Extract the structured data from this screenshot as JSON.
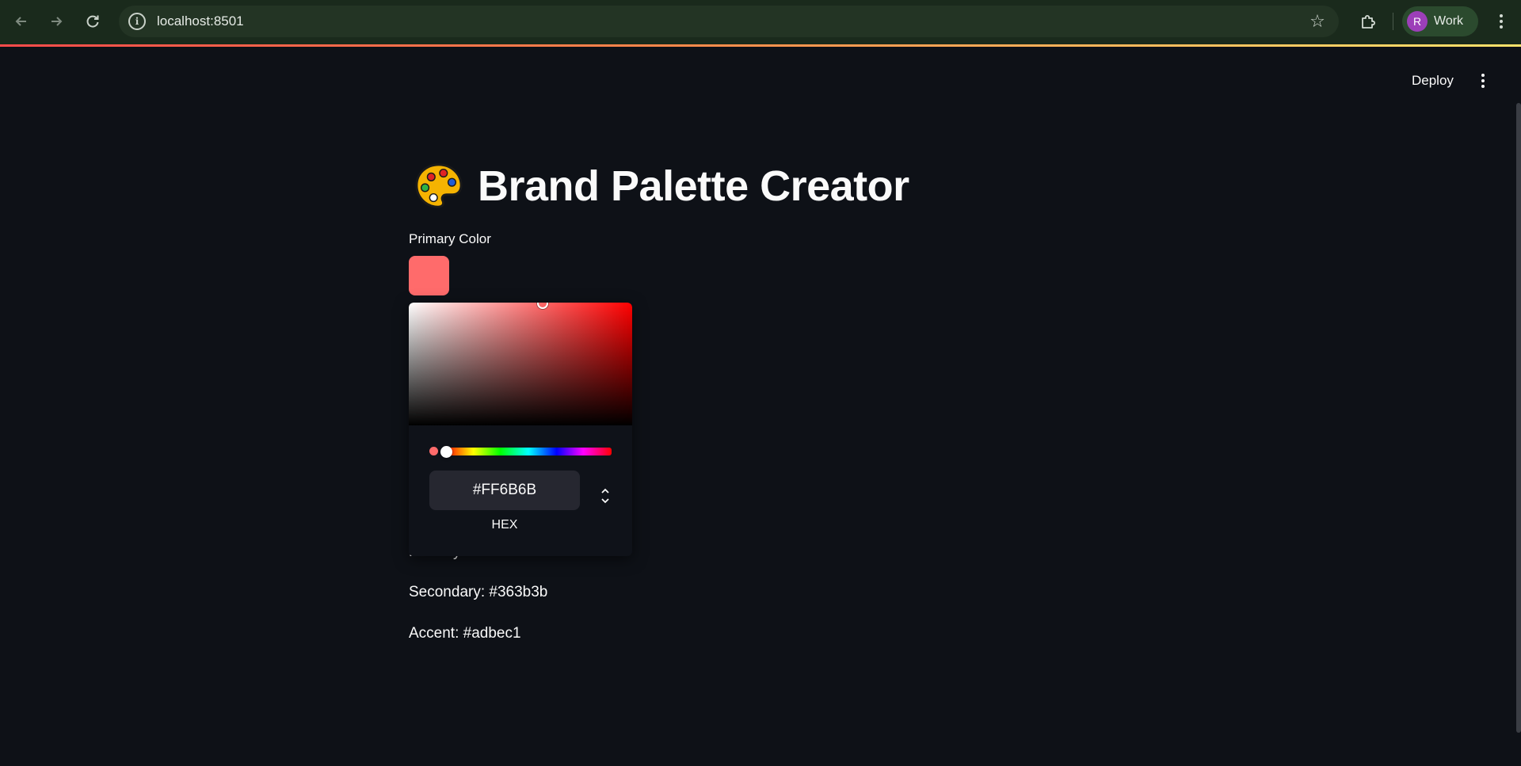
{
  "browser": {
    "url": "localhost:8501",
    "profile_initial": "R",
    "profile_name": "Work",
    "icons": {
      "back": "arrow-left-icon",
      "forward": "arrow-right-icon",
      "reload": "reload-icon",
      "site_info": "info-icon",
      "bookmark": "star-icon",
      "extensions": "puzzle-icon",
      "menu": "kebab-menu-icon"
    }
  },
  "app_header": {
    "deploy_label": "Deploy"
  },
  "page": {
    "title": "Brand Palette Creator",
    "title_icon": "artist-palette-icon"
  },
  "color_picker": {
    "label": "Primary Color",
    "value": "#FF6B6B",
    "format_label": "HEX",
    "swatch_color": "#ff6b6b",
    "hue_color": "#ff0000"
  },
  "palette": {
    "primary_text": "Primary: #FF6B6B",
    "secondary_text": "Secondary: #363b3b",
    "accent_text": "Accent: #adbec1"
  },
  "colors": {
    "background": "#0e1117",
    "text": "#fafafa",
    "browser_chrome": "#1a2a1c"
  }
}
